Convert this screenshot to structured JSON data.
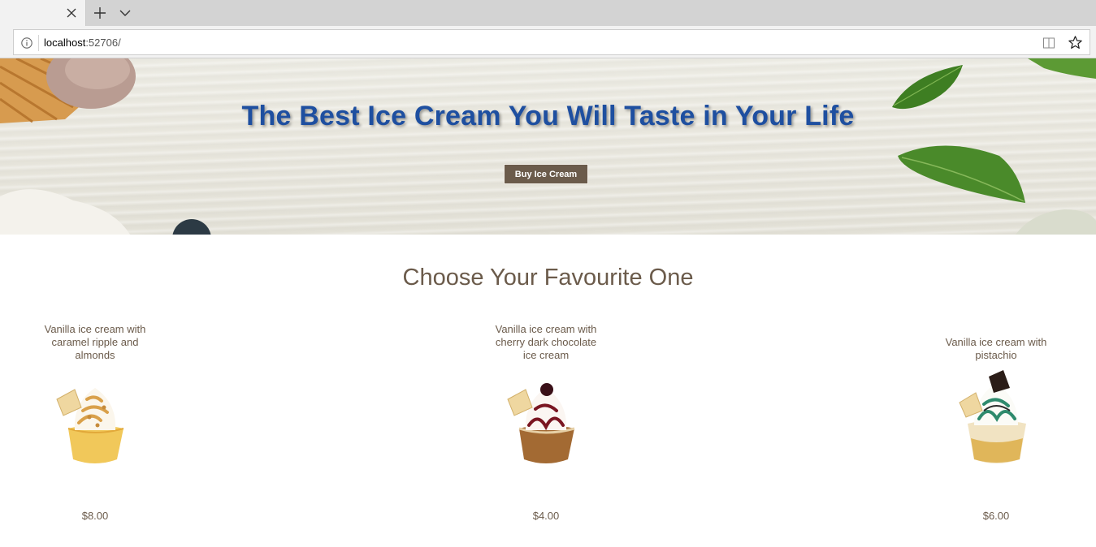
{
  "browser": {
    "url_host": "localhost",
    "url_rest": ":52706/"
  },
  "hero": {
    "title": "The Best Ice Cream You Will Taste in Your Life",
    "button_label": "Buy Ice Cream"
  },
  "section": {
    "title": "Choose Your Favourite One"
  },
  "products": [
    {
      "name": "Vanilla ice cream with caramel ripple and almonds",
      "price": "$8.00",
      "topping_color": "#d9a04a"
    },
    {
      "name": "Vanilla ice cream with cherry dark chocolate ice cream",
      "price": "$4.00",
      "topping_color": "#7a1622"
    },
    {
      "name": "Vanilla ice cream with pistachio",
      "price": "$6.00",
      "topping_color": "#2e8a6d"
    }
  ],
  "colors": {
    "title_blue": "#1e4fa0",
    "brown": "#6b5b4b"
  }
}
